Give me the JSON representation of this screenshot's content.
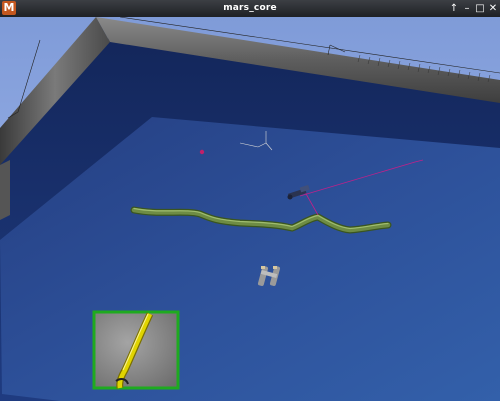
{
  "window": {
    "title": "mars_core",
    "app_icon_letter": "M",
    "buttons": {
      "keep_above": "↑",
      "minimize": "–",
      "maximize": "□",
      "close": "✕"
    }
  },
  "colors": {
    "titlebar": "#2b2e33",
    "sky": "#8fa9e0",
    "floor": "#2a4a8f",
    "wall_inner": "#17306e",
    "wall_top": "#6b6b6b",
    "pipe": "#5c7a3a",
    "laser": "#c0208a",
    "camera_border": "#1faa1f",
    "camera_pipe": "#e0d400"
  },
  "scene": {
    "objects": [
      "arena-floor",
      "arena-wall",
      "green-pipe",
      "robot-sensor",
      "laser-ray",
      "marker-point",
      "gripper-object",
      "camera-inset"
    ]
  }
}
